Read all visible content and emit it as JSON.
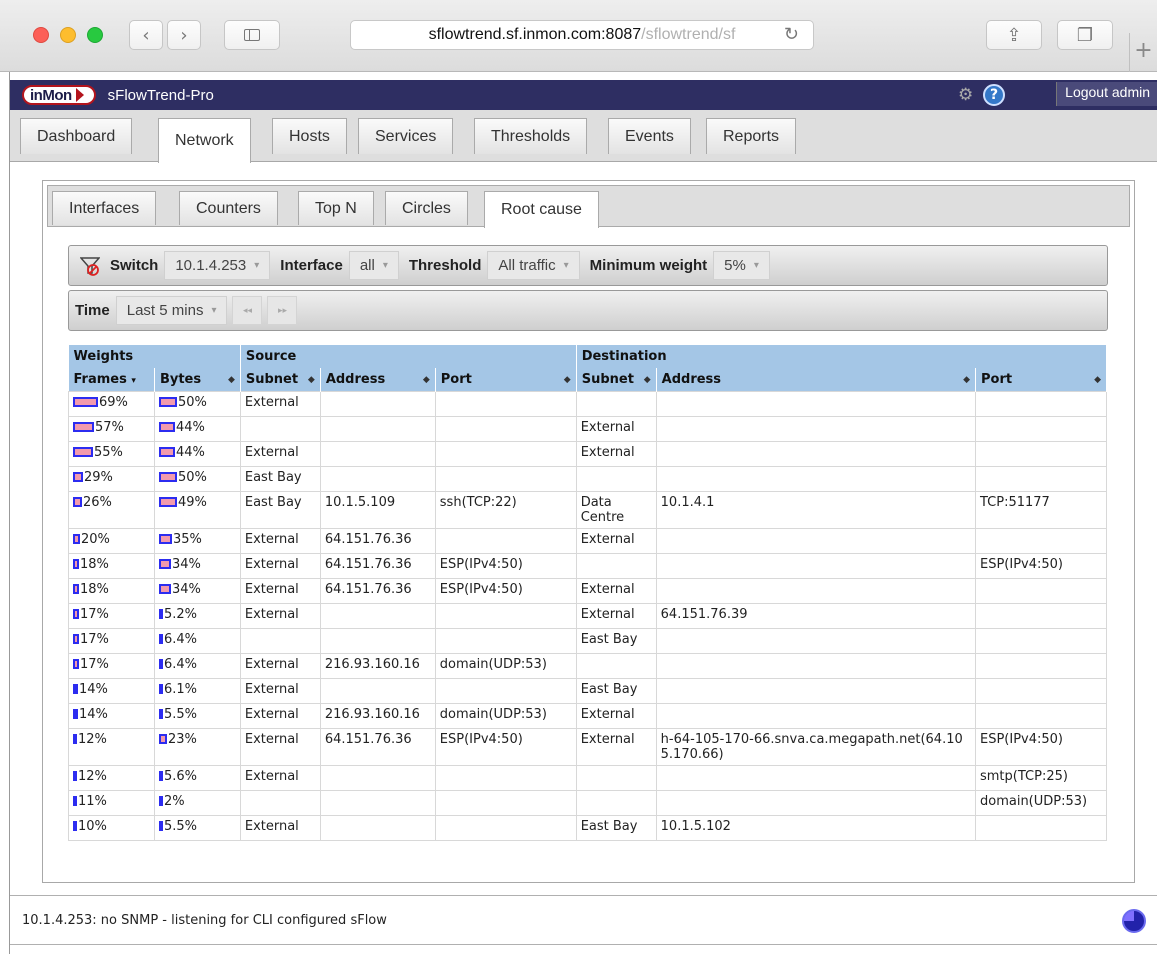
{
  "browser": {
    "url_host": "sflowtrend.sf.inmon.com:8087",
    "url_path": "/sflowtrend/sf"
  },
  "app": {
    "logo_text": "inMon",
    "title": "sFlowTrend-Pro",
    "logout_label": "Logout admin"
  },
  "main_tabs": [
    "Dashboard",
    "Network",
    "Hosts",
    "Services",
    "Thresholds",
    "Events",
    "Reports"
  ],
  "sub_tabs": [
    "Interfaces",
    "Counters",
    "Top N",
    "Circles",
    "Root cause"
  ],
  "filters": {
    "switch_label": "Switch",
    "switch_value": "10.1.4.253",
    "interface_label": "Interface",
    "interface_value": "all",
    "threshold_label": "Threshold",
    "threshold_value": "All traffic",
    "weight_label": "Minimum weight",
    "weight_value": "5%",
    "time_label": "Time",
    "time_value": "Last 5 mins",
    "prev_label": "◂◂",
    "next_label": "▸▸"
  },
  "table": {
    "group_headers": {
      "weights": "Weights",
      "source": "Source",
      "destination": "Destination"
    },
    "columns": [
      "Frames",
      "Bytes",
      "Subnet",
      "Address",
      "Port",
      "Subnet",
      "Address",
      "Port"
    ],
    "rows": [
      {
        "frames": "69%",
        "fw": 69,
        "bytes": "50%",
        "bw": 50,
        "src_subnet": "External",
        "src_addr": "",
        "src_port": "",
        "dst_subnet": "",
        "dst_addr": "",
        "dst_port": ""
      },
      {
        "frames": "57%",
        "fw": 57,
        "bytes": "44%",
        "bw": 44,
        "src_subnet": "",
        "src_addr": "",
        "src_port": "",
        "dst_subnet": "External",
        "dst_addr": "",
        "dst_port": ""
      },
      {
        "frames": "55%",
        "fw": 55,
        "bytes": "44%",
        "bw": 44,
        "src_subnet": "External",
        "src_addr": "",
        "src_port": "",
        "dst_subnet": "External",
        "dst_addr": "",
        "dst_port": ""
      },
      {
        "frames": "29%",
        "fw": 29,
        "bytes": "50%",
        "bw": 50,
        "src_subnet": "East Bay",
        "src_addr": "",
        "src_port": "",
        "dst_subnet": "",
        "dst_addr": "",
        "dst_port": ""
      },
      {
        "frames": "26%",
        "fw": 26,
        "bytes": "49%",
        "bw": 49,
        "src_subnet": "East Bay",
        "src_addr": "10.1.5.109",
        "src_port": "ssh(TCP:22)",
        "dst_subnet": "Data Centre",
        "dst_addr": "10.1.4.1",
        "dst_port": "TCP:51177"
      },
      {
        "frames": "20%",
        "fw": 20,
        "bytes": "35%",
        "bw": 35,
        "src_subnet": "External",
        "src_addr": "64.151.76.36",
        "src_port": "",
        "dst_subnet": "External",
        "dst_addr": "",
        "dst_port": ""
      },
      {
        "frames": "18%",
        "fw": 18,
        "bytes": "34%",
        "bw": 34,
        "src_subnet": "External",
        "src_addr": "64.151.76.36",
        "src_port": "ESP(IPv4:50)",
        "dst_subnet": "",
        "dst_addr": "",
        "dst_port": "ESP(IPv4:50)"
      },
      {
        "frames": "18%",
        "fw": 18,
        "bytes": "34%",
        "bw": 34,
        "src_subnet": "External",
        "src_addr": "64.151.76.36",
        "src_port": "ESP(IPv4:50)",
        "dst_subnet": "External",
        "dst_addr": "",
        "dst_port": ""
      },
      {
        "frames": "17%",
        "fw": 17,
        "bytes": "5.2%",
        "bw": 5.2,
        "src_subnet": "External",
        "src_addr": "",
        "src_port": "",
        "dst_subnet": "External",
        "dst_addr": "64.151.76.39",
        "dst_port": ""
      },
      {
        "frames": "17%",
        "fw": 17,
        "bytes": "6.4%",
        "bw": 6.4,
        "src_subnet": "",
        "src_addr": "",
        "src_port": "",
        "dst_subnet": "East Bay",
        "dst_addr": "",
        "dst_port": ""
      },
      {
        "frames": "17%",
        "fw": 17,
        "bytes": "6.4%",
        "bw": 6.4,
        "src_subnet": "External",
        "src_addr": "216.93.160.16",
        "src_port": "domain(UDP:53)",
        "dst_subnet": "",
        "dst_addr": "",
        "dst_port": ""
      },
      {
        "frames": "14%",
        "fw": 14,
        "bytes": "6.1%",
        "bw": 6.1,
        "src_subnet": "External",
        "src_addr": "",
        "src_port": "",
        "dst_subnet": "East Bay",
        "dst_addr": "",
        "dst_port": ""
      },
      {
        "frames": "14%",
        "fw": 14,
        "bytes": "5.5%",
        "bw": 5.5,
        "src_subnet": "External",
        "src_addr": "216.93.160.16",
        "src_port": "domain(UDP:53)",
        "dst_subnet": "External",
        "dst_addr": "",
        "dst_port": ""
      },
      {
        "frames": "12%",
        "fw": 12,
        "bytes": "23%",
        "bw": 23,
        "src_subnet": "External",
        "src_addr": "64.151.76.36",
        "src_port": "ESP(IPv4:50)",
        "dst_subnet": "External",
        "dst_addr": "h-64-105-170-66.snva.ca.megapath.net(64.105.170.66)",
        "dst_port": "ESP(IPv4:50)"
      },
      {
        "frames": "12%",
        "fw": 12,
        "bytes": "5.6%",
        "bw": 5.6,
        "src_subnet": "External",
        "src_addr": "",
        "src_port": "",
        "dst_subnet": "",
        "dst_addr": "",
        "dst_port": "smtp(TCP:25)"
      },
      {
        "frames": "11%",
        "fw": 11,
        "bytes": "2%",
        "bw": 2,
        "src_subnet": "",
        "src_addr": "",
        "src_port": "",
        "dst_subnet": "",
        "dst_addr": "",
        "dst_port": "domain(UDP:53)"
      },
      {
        "frames": "10%",
        "fw": 10,
        "bytes": "5.5%",
        "bw": 5.5,
        "src_subnet": "External",
        "src_addr": "",
        "src_port": "",
        "dst_subnet": "East Bay",
        "dst_addr": "10.1.5.102",
        "dst_port": ""
      }
    ]
  },
  "status_text": "10.1.4.253: no SNMP - listening for CLI configured sFlow"
}
